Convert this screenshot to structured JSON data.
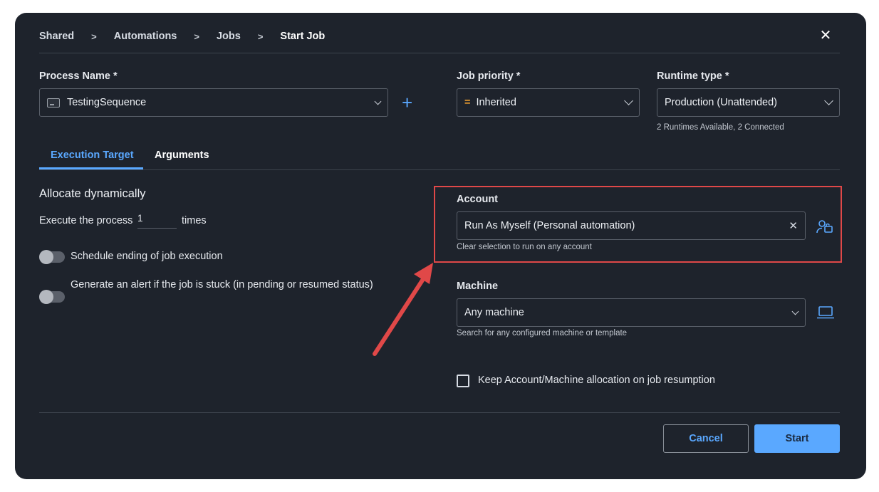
{
  "breadcrumb": [
    "Shared",
    "Automations",
    "Jobs",
    "Start Job"
  ],
  "process": {
    "label": "Process Name *",
    "value": "TestingSequence"
  },
  "priority": {
    "label": "Job priority *",
    "value": "Inherited",
    "icon": "="
  },
  "runtime": {
    "label": "Runtime type *",
    "value": "Production (Unattended)",
    "helper": "2 Runtimes Available, 2 Connected"
  },
  "tabs": [
    "Execution Target",
    "Arguments"
  ],
  "left": {
    "heading": "Allocate dynamically",
    "execute_prefix": "Execute the process",
    "execute_count": "1",
    "execute_suffix": "times",
    "toggle1": "Schedule ending of job execution",
    "toggle2": "Generate an alert if the job is stuck (in pending or resumed status)"
  },
  "account": {
    "label": "Account",
    "value": "Run As Myself (Personal automation)",
    "helper": "Clear selection to run on any account"
  },
  "machine": {
    "label": "Machine",
    "value": "Any machine",
    "helper": "Search for any configured machine or template"
  },
  "keep_allocation": "Keep Account/Machine allocation on job resumption",
  "buttons": {
    "cancel": "Cancel",
    "start": "Start"
  },
  "colors": {
    "accent": "#5aa8ff",
    "highlight": "#e04848",
    "background": "#1e232c"
  }
}
